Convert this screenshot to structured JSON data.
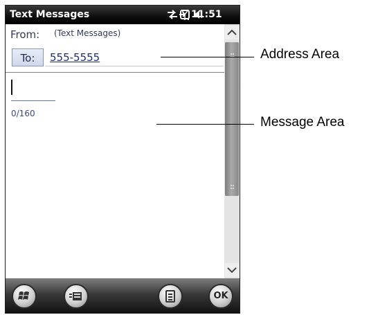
{
  "status_bar": {
    "title": "Text Messages",
    "time": "11:51",
    "icons": [
      "data-sync-icon",
      "signal-icon",
      "speaker-icon",
      "battery-charging-icon"
    ]
  },
  "address_area": {
    "from_label": "From:",
    "from_value": "(Text Messages)",
    "to_button_label": "To:",
    "to_value": "555-5555"
  },
  "message_area": {
    "char_count": "0/160"
  },
  "softkeys": {
    "ok_label": "OK",
    "buttons": [
      "windows-start-icon",
      "message-options-icon",
      "menu-icon",
      "ok-button"
    ]
  },
  "callouts": {
    "address": "Address Area",
    "message": "Message Area"
  }
}
